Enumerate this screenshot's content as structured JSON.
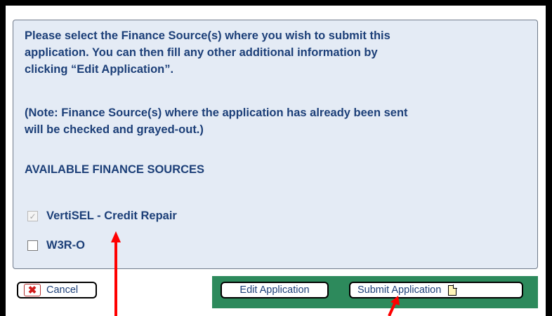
{
  "instructions": {
    "line1": "Please select the Finance Source(s) where you wish to submit this",
    "line2": "application.  You can then fill any other additional information by",
    "line3": "clicking “Edit Application”.",
    "note_line1": "(Note: Finance Source(s) where the application has already been sent",
    "note_line2": "will be checked and grayed-out.)"
  },
  "sources_heading": "AVAILABLE FINANCE SOURCES",
  "finance_sources": [
    {
      "label": "VertiSEL - Credit Repair",
      "checked": true,
      "disabled": true
    },
    {
      "label": "W3R-O",
      "checked": false,
      "disabled": false
    }
  ],
  "buttons": {
    "cancel_label": "Cancel",
    "edit_label": "Edit Application",
    "submit_label": "Submit Application"
  },
  "icons": {
    "cancel": "cancel-x-icon",
    "submit": "document-icon",
    "check": "checkmark-icon"
  },
  "colors": {
    "text": "#1c3f78",
    "panel_bg": "#e4ebf5",
    "action_bar": "#2d8a5c",
    "annotation_arrow": "#ff0000",
    "cancel_x": "#d11a1a"
  }
}
